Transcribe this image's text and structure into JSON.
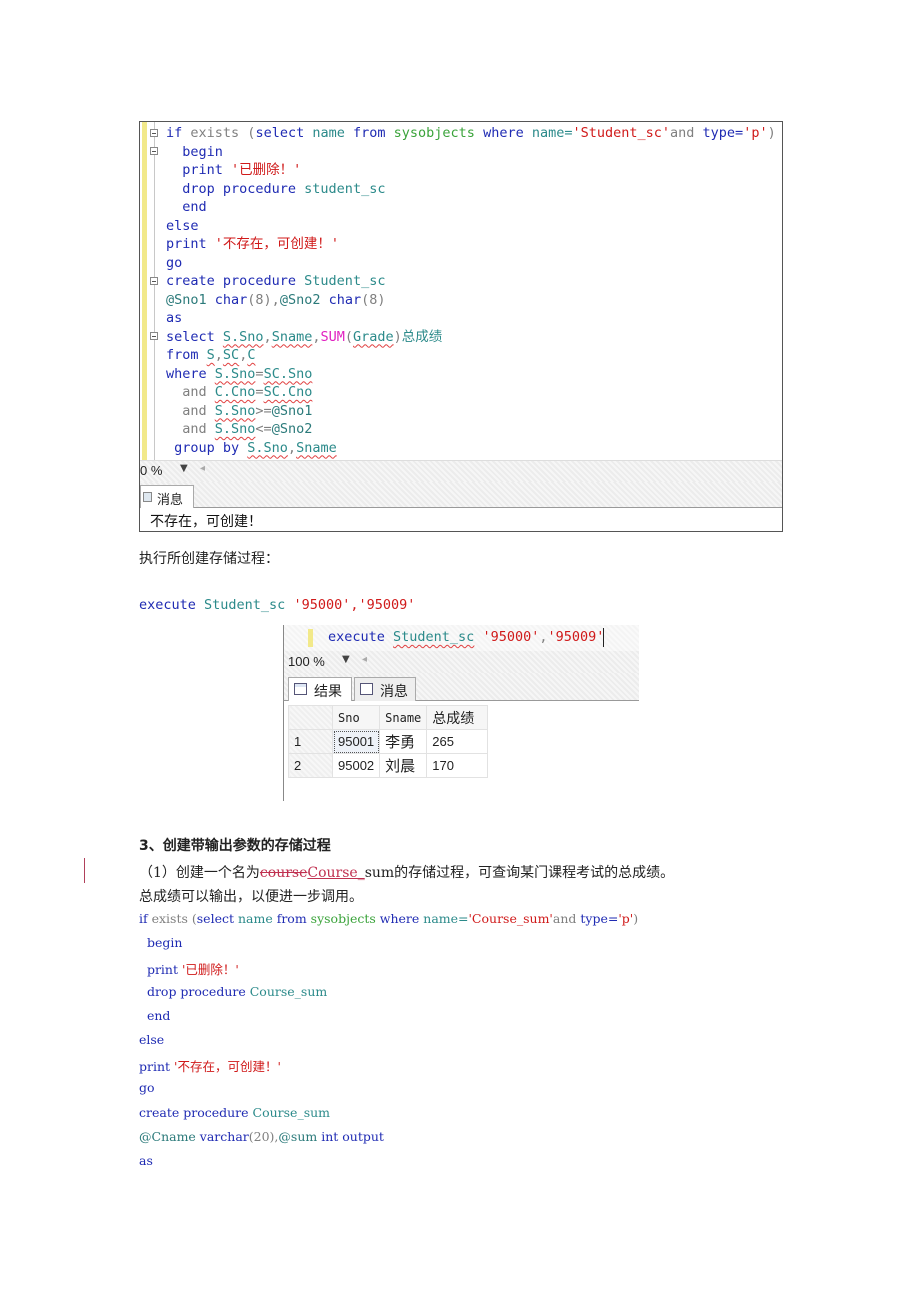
{
  "screenshot1": {
    "code_lines": [
      [
        {
          "t": "if",
          "c": "kw"
        },
        {
          "t": " exists ",
          "c": "gray"
        },
        {
          "t": "(",
          "c": "gray"
        },
        {
          "t": "select",
          "c": "kw"
        },
        {
          "t": " name ",
          "c": "obj"
        },
        {
          "t": "from",
          "c": "kw"
        },
        {
          "t": " sysobjects ",
          "c": "sys"
        },
        {
          "t": "where",
          "c": "kw"
        },
        {
          "t": " name=",
          "c": "obj"
        },
        {
          "t": "'Student_sc'",
          "c": "str"
        },
        {
          "t": "and",
          "c": "gray"
        },
        {
          "t": " type=",
          "c": "kw"
        },
        {
          "t": "'p'",
          "c": "str"
        },
        {
          "t": ")",
          "c": "gray"
        }
      ],
      [
        {
          "t": "  begin",
          "c": "kw"
        }
      ],
      [
        {
          "t": "  print ",
          "c": "kw"
        },
        {
          "t": "'已删除！'",
          "c": "str"
        }
      ],
      [
        {
          "t": "  drop procedure ",
          "c": "kw"
        },
        {
          "t": "student_sc",
          "c": "obj"
        }
      ],
      [
        {
          "t": "  end",
          "c": "kw"
        }
      ],
      [
        {
          "t": "else",
          "c": "kw"
        }
      ],
      [
        {
          "t": "print ",
          "c": "kw"
        },
        {
          "t": "'不存在，可创建！'",
          "c": "str"
        }
      ],
      [
        {
          "t": "go",
          "c": "kw"
        }
      ],
      [
        {
          "t": "create procedure ",
          "c": "kw"
        },
        {
          "t": "Student_sc",
          "c": "obj"
        }
      ],
      [
        {
          "t": "@Sno1 ",
          "c": "var"
        },
        {
          "t": "char",
          "c": "kw"
        },
        {
          "t": "(8),",
          "c": "gray"
        },
        {
          "t": "@Sno2 ",
          "c": "var"
        },
        {
          "t": "char",
          "c": "kw"
        },
        {
          "t": "(8)",
          "c": "gray"
        }
      ],
      [
        {
          "t": "as",
          "c": "kw"
        }
      ],
      [
        {
          "t": "select ",
          "c": "kw"
        },
        {
          "t": "S.Sno",
          "c": "obj",
          "sq": true
        },
        {
          "t": ",",
          "c": "gray"
        },
        {
          "t": "Sname",
          "c": "obj",
          "sq": true
        },
        {
          "t": ",",
          "c": "gray"
        },
        {
          "t": "SUM",
          "c": "fn"
        },
        {
          "t": "(",
          "c": "gray"
        },
        {
          "t": "Grade",
          "c": "obj",
          "sq": true
        },
        {
          "t": ")",
          "c": "gray"
        },
        {
          "t": "总成绩",
          "c": "obj"
        }
      ],
      [
        {
          "t": "from ",
          "c": "kw"
        },
        {
          "t": "S",
          "c": "obj",
          "sq": true
        },
        {
          "t": ",",
          "c": "gray"
        },
        {
          "t": "SC",
          "c": "obj",
          "sq": true
        },
        {
          "t": ",",
          "c": "gray"
        },
        {
          "t": "C",
          "c": "obj",
          "sq": true
        }
      ],
      [
        {
          "t": "where ",
          "c": "kw"
        },
        {
          "t": "S.Sno",
          "c": "obj",
          "sq": true
        },
        {
          "t": "=",
          "c": "gray"
        },
        {
          "t": "SC.Sno",
          "c": "obj",
          "sq": true
        }
      ],
      [
        {
          "t": "  and ",
          "c": "gray"
        },
        {
          "t": "C.Cno",
          "c": "obj",
          "sq": true
        },
        {
          "t": "=",
          "c": "gray"
        },
        {
          "t": "SC.Cno",
          "c": "obj",
          "sq": true
        }
      ],
      [
        {
          "t": "  and ",
          "c": "gray"
        },
        {
          "t": "S.Sno",
          "c": "obj",
          "sq": true
        },
        {
          "t": ">=",
          "c": "gray"
        },
        {
          "t": "@Sno1",
          "c": "var"
        }
      ],
      [
        {
          "t": "  and ",
          "c": "gray"
        },
        {
          "t": "S.Sno",
          "c": "obj",
          "sq": true
        },
        {
          "t": "<=",
          "c": "gray"
        },
        {
          "t": "@Sno2",
          "c": "var"
        }
      ],
      [
        {
          "t": " group by ",
          "c": "kw"
        },
        {
          "t": "S.Sno",
          "c": "obj",
          "sq": true
        },
        {
          "t": ",",
          "c": "gray"
        },
        {
          "t": "Sname",
          "c": "obj",
          "sq": true
        }
      ]
    ],
    "zoom_level": "0 %",
    "tab_label": "消息",
    "message": "不存在，可创建！"
  },
  "text1": "执行所创建存储过程：",
  "execute_line": [
    {
      "t": "execute ",
      "c": "kw"
    },
    {
      "t": "Student_sc ",
      "c": "obj"
    },
    {
      "t": "'95000','95009'",
      "c": "str"
    }
  ],
  "screenshot2": {
    "exec_line": [
      {
        "t": "execute ",
        "c": "kw"
      },
      {
        "t": "Student_sc",
        "c": "obj",
        "sq": true
      },
      {
        "t": " ",
        "c": "plain"
      },
      {
        "t": "'95000'",
        "c": "str"
      },
      {
        "t": ",",
        "c": "gray"
      },
      {
        "t": "'95009'",
        "c": "str"
      }
    ],
    "zoom_level": "100 %",
    "tabs": [
      "结果",
      "消息"
    ],
    "columns": [
      "Sno",
      "Sname",
      "总成绩"
    ],
    "rows": [
      {
        "num": "1",
        "Sno": "95001",
        "Sname": "李勇",
        "total": "265"
      },
      {
        "num": "2",
        "Sno": "95002",
        "Sname": "刘晨",
        "total": "170"
      }
    ]
  },
  "section3": {
    "heading": "3、创建带输出参数的存储过程",
    "para_prefix": "（1）创建一个名为",
    "deleted": "course",
    "inserted": "Course_",
    "para_suffix": "sum的存储过程，可查询某门课程考试的总成绩。",
    "para_line2": "总成绩可以输出，以便进一步调用。"
  },
  "code2_lines": [
    [
      {
        "t": "if",
        "c": "kw"
      },
      {
        "t": " exists ",
        "c": "gray"
      },
      {
        "t": "(",
        "c": "gray"
      },
      {
        "t": "select",
        "c": "kw"
      },
      {
        "t": " name ",
        "c": "obj"
      },
      {
        "t": "from",
        "c": "kw"
      },
      {
        "t": " sysobjects ",
        "c": "sys"
      },
      {
        "t": "where",
        "c": "kw"
      },
      {
        "t": " name=",
        "c": "obj"
      },
      {
        "t": "'Course_sum'",
        "c": "str"
      },
      {
        "t": "and",
        "c": "gray"
      },
      {
        "t": " type=",
        "c": "kw"
      },
      {
        "t": "'p'",
        "c": "str"
      },
      {
        "t": ")",
        "c": "gray"
      }
    ],
    [
      {
        "t": "  begin",
        "c": "kw"
      }
    ],
    [
      {
        "t": "  print ",
        "c": "kw"
      },
      {
        "t": "'已删除！'",
        "c": "str"
      }
    ],
    [
      {
        "t": "  drop procedure ",
        "c": "kw"
      },
      {
        "t": "Course_sum",
        "c": "obj"
      }
    ],
    [
      {
        "t": "  end",
        "c": "kw"
      }
    ],
    [
      {
        "t": "else",
        "c": "kw"
      }
    ],
    [
      {
        "t": "print ",
        "c": "kw"
      },
      {
        "t": "'不存在，可创建！'",
        "c": "str"
      }
    ],
    [
      {
        "t": "go",
        "c": "kw"
      }
    ],
    [
      {
        "t": "create procedure ",
        "c": "kw"
      },
      {
        "t": "Course_sum",
        "c": "obj"
      }
    ],
    [
      {
        "t": "@Cname ",
        "c": "var"
      },
      {
        "t": "varchar",
        "c": "kw"
      },
      {
        "t": "(20),",
        "c": "gray"
      },
      {
        "t": "@sum ",
        "c": "var"
      },
      {
        "t": "int output",
        "c": "kw"
      }
    ],
    [
      {
        "t": "as",
        "c": "kw"
      }
    ]
  ]
}
